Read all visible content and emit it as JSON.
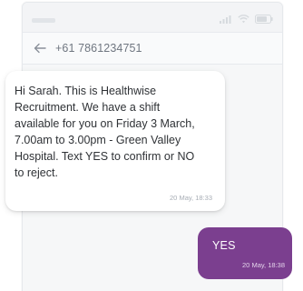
{
  "header": {
    "contact_number": "+61 7861234751"
  },
  "icons": {
    "back": "arrow-left",
    "signal": "signal-bars",
    "wifi": "wifi",
    "battery": "battery"
  },
  "messages": [
    {
      "direction": "incoming",
      "text": "Hi Sarah. This is Healthwise\nRecruitment. We have a shift\navailable for you on Friday 3 March,\n7.00am to 3.00pm - Green Valley\nHospital. Text YES to confirm or NO\nto reject.",
      "timestamp": "20 May, 18:33"
    },
    {
      "direction": "outgoing",
      "text": "YES",
      "timestamp": "20 May, 18:38"
    }
  ],
  "colors": {
    "outgoing_bubble": "#7b3f8f",
    "incoming_bubble": "#ffffff",
    "background": "#f6f7f8"
  }
}
